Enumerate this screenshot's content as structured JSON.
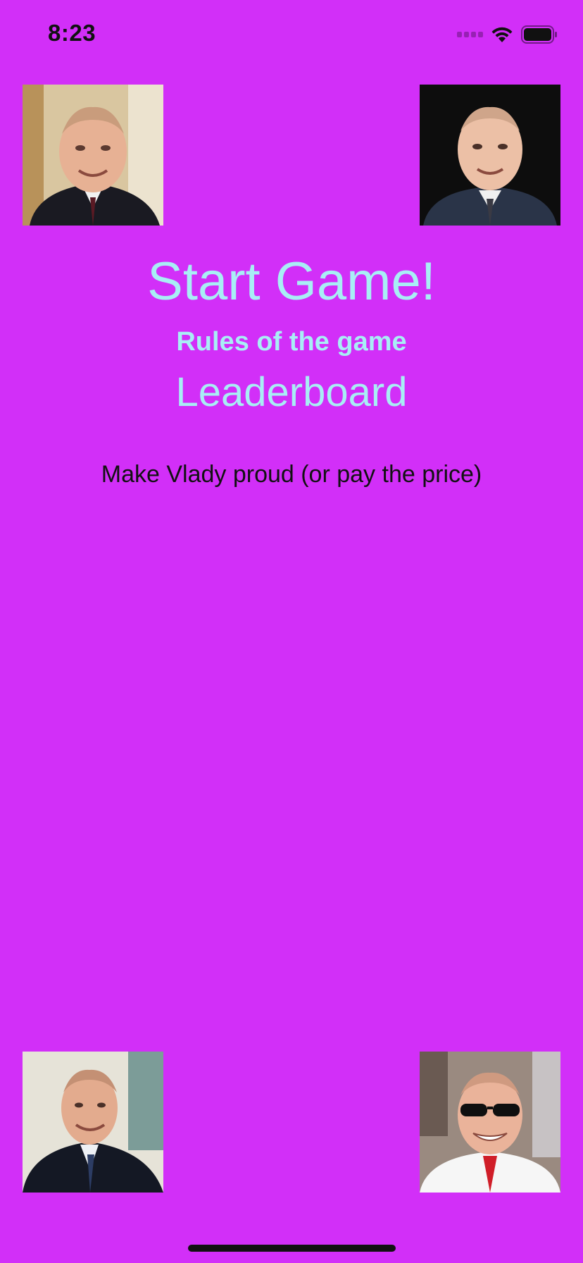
{
  "status_bar": {
    "time": "8:23",
    "icons": [
      "signal-dots-icon",
      "wifi-icon",
      "battery-icon"
    ]
  },
  "menu": {
    "start_label": "Start Game!",
    "rules_label": "Rules of the game",
    "leaderboard_label": "Leaderboard",
    "tagline": "Make Vlady proud (or pay the price)"
  },
  "photos": [
    {
      "position": "top-left",
      "alt": "smiling man portrait"
    },
    {
      "position": "top-right",
      "alt": "smiling man portrait"
    },
    {
      "position": "bottom-left",
      "alt": "smiling man portrait"
    },
    {
      "position": "bottom-right",
      "alt": "man with sunglasses portrait"
    }
  ],
  "colors": {
    "background": "#d22ff8",
    "menu_text": "#a8eef5",
    "tagline_text": "#111111"
  }
}
